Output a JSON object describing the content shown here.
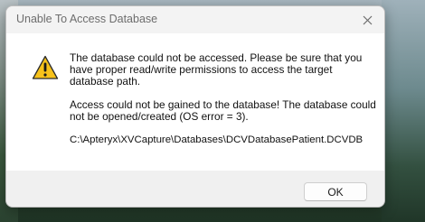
{
  "dialog": {
    "title": "Unable To Access Database",
    "close_icon": "close-icon",
    "icon": "warning-icon",
    "colors": {
      "warning_fill": "#f7c21b",
      "warning_outline": "#2b2b2b",
      "content_bg": "#ffffff",
      "chrome_bg": "#f0f0f0"
    },
    "messages": [
      "The database could not be accessed.  Please be sure that you have proper read/write permissions to access the target database path.",
      "Access could not be gained to the database!  The database could not be opened/created (OS error = 3).",
      "C:\\Apteryx\\XVCapture\\Databases\\DCVDatabasePatient.DCVDB"
    ],
    "ok_label": "OK"
  }
}
